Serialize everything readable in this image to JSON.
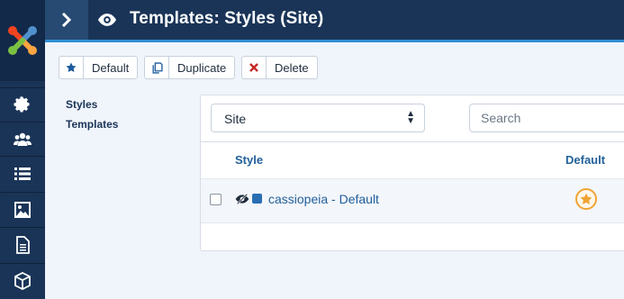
{
  "header": {
    "title": "Templates: Styles (Site)"
  },
  "toolbar": {
    "default_label": "Default",
    "duplicate_label": "Duplicate",
    "delete_label": "Delete"
  },
  "submenu": {
    "styles": "Styles",
    "templates": "Templates"
  },
  "filters": {
    "client_select_value": "Site",
    "search_placeholder": "Search"
  },
  "table": {
    "headers": {
      "style": "Style",
      "default": "Default"
    },
    "rows": [
      {
        "name": "cassiopeia - Default",
        "is_default": true
      }
    ]
  },
  "sidebar": {
    "icons": [
      "joomla-logo",
      "gear-icon",
      "users-icon",
      "list-icon",
      "image-icon",
      "file-icon",
      "cube-icon"
    ]
  },
  "colors": {
    "sidebar": "#1a3457",
    "accent": "#2f8fd3",
    "link": "#22609b",
    "star": "#f0a334"
  }
}
